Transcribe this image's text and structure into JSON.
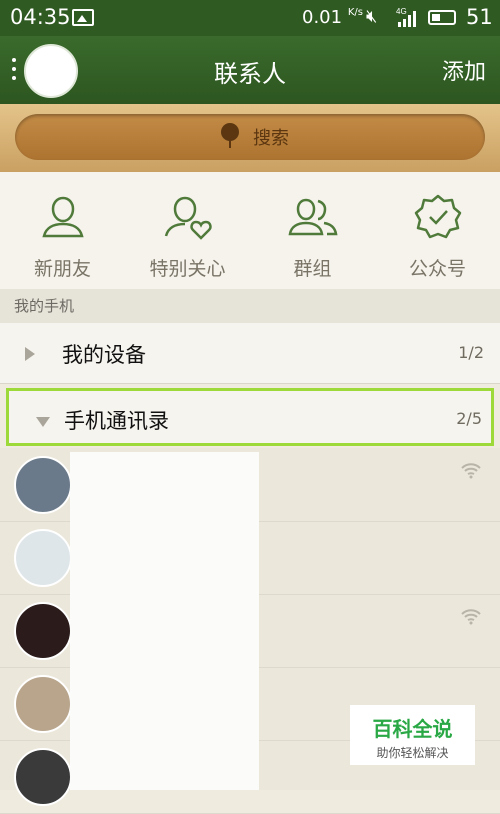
{
  "status_bar": {
    "time": "04:35",
    "speed": "0.01",
    "speed_unit": "K/s",
    "network": "4G",
    "battery": "51"
  },
  "header": {
    "title": "联系人",
    "add_label": "添加"
  },
  "search": {
    "label": "搜索"
  },
  "quick_actions": [
    {
      "label": "新朋友",
      "icon": "person-icon"
    },
    {
      "label": "特别关心",
      "icon": "person-heart-icon"
    },
    {
      "label": "群组",
      "icon": "group-icon"
    },
    {
      "label": "公众号",
      "icon": "verified-badge-icon"
    }
  ],
  "section_title": "我的手机",
  "groups": [
    {
      "label": "我的设备",
      "count": "1/2",
      "expanded": false
    },
    {
      "label": "手机通讯录",
      "count": "2/5",
      "expanded": true
    }
  ],
  "contacts": [
    {
      "avatar_color": "#6b7a8a",
      "online": true
    },
    {
      "avatar_color": "#dfe6ea",
      "online": false
    },
    {
      "avatar_color": "#2b1b1b",
      "online": true
    },
    {
      "avatar_color": "#b8a58c",
      "online": false
    },
    {
      "avatar_color": "#3a3a3a",
      "online": false
    }
  ],
  "watermark": {
    "main": "百科全说",
    "sub": "助你轻松解决"
  },
  "colors": {
    "header": "#2f5a22",
    "selection": "#9ed93a",
    "icon": "#4f7a3a"
  }
}
